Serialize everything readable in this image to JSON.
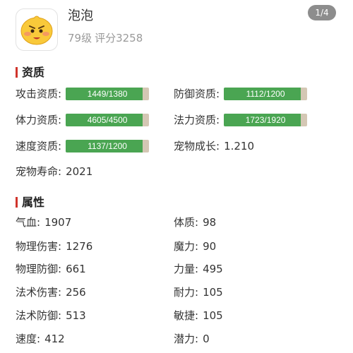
{
  "pet": {
    "name": "泡泡",
    "level": "79级",
    "score": "评分3258"
  },
  "pager": "1/4",
  "sections": {
    "aptitude": "资质",
    "attributes": "属性"
  },
  "aptitude": [
    {
      "label": "攻击资质:",
      "value": "1449/1380",
      "fill": 0.92
    },
    {
      "label": "防御资质:",
      "value": "1112/1200",
      "fill": 0.92
    },
    {
      "label": "体力资质:",
      "value": "4605/4500",
      "fill": 0.92
    },
    {
      "label": "法力资质:",
      "value": "1723/1920",
      "fill": 0.92
    },
    {
      "label": "速度资质:",
      "value": "1137/1200",
      "fill": 0.92
    }
  ],
  "growth": {
    "label": "宠物成长:",
    "value": "1.210"
  },
  "lifespan": {
    "label": "宠物寿命:",
    "value": "2021"
  },
  "attributes": [
    {
      "label": "气血:",
      "value": "1907"
    },
    {
      "label": "体质:",
      "value": "98"
    },
    {
      "label": "物理伤害:",
      "value": "1276"
    },
    {
      "label": "魔力:",
      "value": "90"
    },
    {
      "label": "物理防御:",
      "value": "661"
    },
    {
      "label": "力量:",
      "value": "495"
    },
    {
      "label": "法术伤害:",
      "value": "256"
    },
    {
      "label": "耐力:",
      "value": "105"
    },
    {
      "label": "法术防御:",
      "value": "513"
    },
    {
      "label": "敏捷:",
      "value": "105"
    },
    {
      "label": "速度:",
      "value": "412"
    },
    {
      "label": "潜力:",
      "value": "0"
    }
  ],
  "colors": {
    "accent": "#d0342c",
    "bar_fill": "#4aa552",
    "bar_track": "#d4c7b4",
    "pager_bg": "#8d8d8d"
  },
  "icons": {
    "avatar": "yellow-bun-face-icon"
  }
}
